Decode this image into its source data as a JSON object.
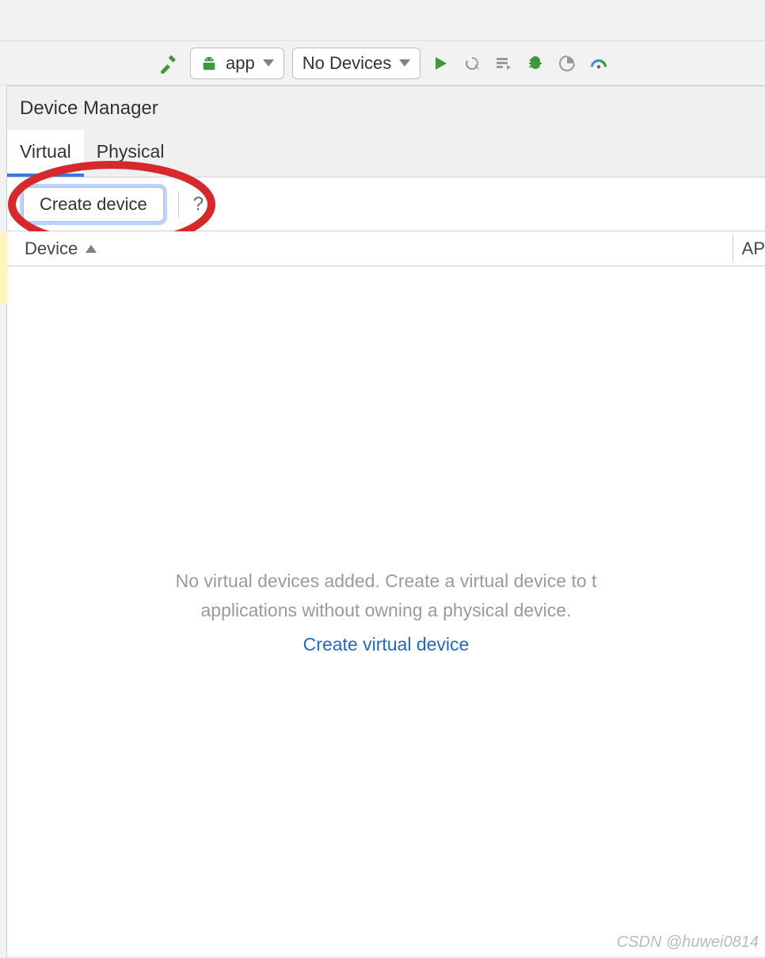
{
  "toolbar": {
    "config_label": "app",
    "device_label": "No Devices"
  },
  "panel": {
    "title": "Device Manager",
    "tabs": {
      "virtual": "Virtual",
      "physical": "Physical"
    },
    "create_button": "Create device",
    "help_glyph": "?",
    "columns": {
      "device": "Device",
      "api": "AP"
    },
    "empty_message_line1": "No virtual devices added. Create a virtual device to t",
    "empty_message_line2": "applications without owning a physical device.",
    "empty_link": "Create virtual device"
  },
  "watermark": "CSDN @huwei0814"
}
